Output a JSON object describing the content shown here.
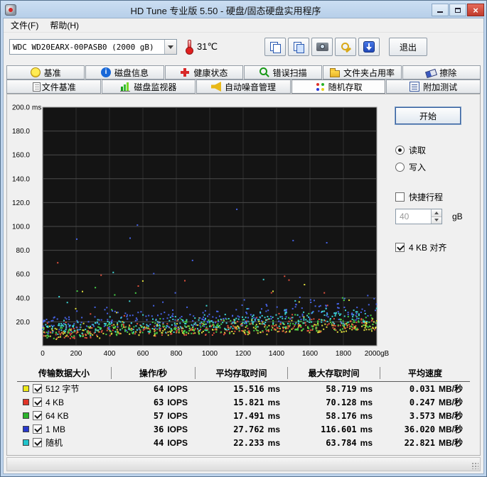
{
  "window": {
    "title": "HD Tune 专业版 5.50 - 硬盘/固态硬盘实用程序"
  },
  "menu": {
    "items": [
      "文件(F)",
      "帮助(H)"
    ]
  },
  "toolbar": {
    "drive": "WDC WD20EARX-00PASB0  (2000 gB)",
    "temperature": "31℃",
    "exit_label": "退出"
  },
  "tabs": {
    "row1": [
      {
        "label": "基准"
      },
      {
        "label": "磁盘信息"
      },
      {
        "label": "健康状态"
      },
      {
        "label": "错误扫描"
      },
      {
        "label": "文件夹占用率"
      },
      {
        "label": "擦除"
      }
    ],
    "row2": [
      {
        "label": "文件基准"
      },
      {
        "label": "磁盘监视器"
      },
      {
        "label": "自动噪音管理"
      },
      {
        "label": "随机存取",
        "active": true
      },
      {
        "label": "附加测试"
      }
    ]
  },
  "controls": {
    "start_label": "开始",
    "read_label": "读取",
    "read_selected": true,
    "write_label": "写入",
    "write_selected": false,
    "shortstroke_label": "快捷行程",
    "shortstroke_checked": false,
    "shortstroke_value": "40",
    "shortstroke_unit": "gB",
    "align_label": "4 KB 对齐",
    "align_checked": true
  },
  "chart_data": {
    "type": "scatter",
    "xlabel": "gB",
    "ylabel": "ms",
    "xlim": [
      0,
      2000
    ],
    "ylim": [
      0,
      200
    ],
    "x_ticks": [
      0,
      200,
      400,
      600,
      800,
      1000,
      1200,
      1400,
      1600,
      1800,
      2000
    ],
    "x_tick_labels": [
      "0",
      "200",
      "400",
      "600",
      "800",
      "1000",
      "1200",
      "1400",
      "1600",
      "1800",
      "2000gB"
    ],
    "y_ticks": [
      20,
      40,
      60,
      80,
      100,
      120,
      140,
      160,
      180,
      200
    ],
    "grid": true,
    "plot_bg": "#141414",
    "legend_position": "table-below",
    "series": [
      {
        "name": "512 字节",
        "color": "#dede3c",
        "mean_access_ms": 15.516,
        "max_access_ms": 58.719,
        "iops": 64,
        "avg_speed_mb_s": 0.031
      },
      {
        "name": "4 KB",
        "color": "#e0503c",
        "mean_access_ms": 15.821,
        "max_access_ms": 70.128,
        "iops": 63,
        "avg_speed_mb_s": 0.247
      },
      {
        "name": "64 KB",
        "color": "#46cf46",
        "mean_access_ms": 17.491,
        "max_access_ms": 58.176,
        "iops": 57,
        "avg_speed_mb_s": 3.573
      },
      {
        "name": "1 MB",
        "color": "#4663e6",
        "mean_access_ms": 27.762,
        "max_access_ms": 116.601,
        "iops": 36,
        "avg_speed_mb_s": 36.02
      },
      {
        "name": "随机",
        "color": "#3ed4d4",
        "mean_access_ms": 22.233,
        "max_access_ms": 63.784,
        "iops": 44,
        "avg_speed_mb_s": 22.821
      }
    ]
  },
  "table": {
    "headers": [
      "传输数据大小",
      "操作/秒",
      "平均存取时间",
      "最大存取时间",
      "平均速度"
    ],
    "rows": [
      {
        "swatch": "#ece81a",
        "checked": true,
        "label": "512 字节",
        "ops": "64",
        "ops_unit": "IOPS",
        "avg": "15.516",
        "avg_unit": "ms",
        "max": "58.719",
        "max_unit": "ms",
        "speed": "0.031",
        "speed_unit": "MB/秒"
      },
      {
        "swatch": "#e03428",
        "checked": true,
        "label": "4 KB",
        "ops": "63",
        "ops_unit": "IOPS",
        "avg": "15.821",
        "avg_unit": "ms",
        "max": "70.128",
        "max_unit": "ms",
        "speed": "0.247",
        "speed_unit": "MB/秒"
      },
      {
        "swatch": "#2cb42c",
        "checked": true,
        "label": "64 KB",
        "ops": "57",
        "ops_unit": "IOPS",
        "avg": "17.491",
        "avg_unit": "ms",
        "max": "58.176",
        "max_unit": "ms",
        "speed": "3.573",
        "speed_unit": "MB/秒"
      },
      {
        "swatch": "#2838cc",
        "checked": true,
        "label": "1 MB",
        "ops": "36",
        "ops_unit": "IOPS",
        "avg": "27.762",
        "avg_unit": "ms",
        "max": "116.601",
        "max_unit": "ms",
        "speed": "36.020",
        "speed_unit": "MB/秒"
      },
      {
        "swatch": "#22c4cc",
        "checked": true,
        "label": "随机",
        "ops": "44",
        "ops_unit": "IOPS",
        "avg": "22.233",
        "avg_unit": "ms",
        "max": "63.784",
        "max_unit": "ms",
        "speed": "22.821",
        "speed_unit": "MB/秒"
      }
    ]
  }
}
